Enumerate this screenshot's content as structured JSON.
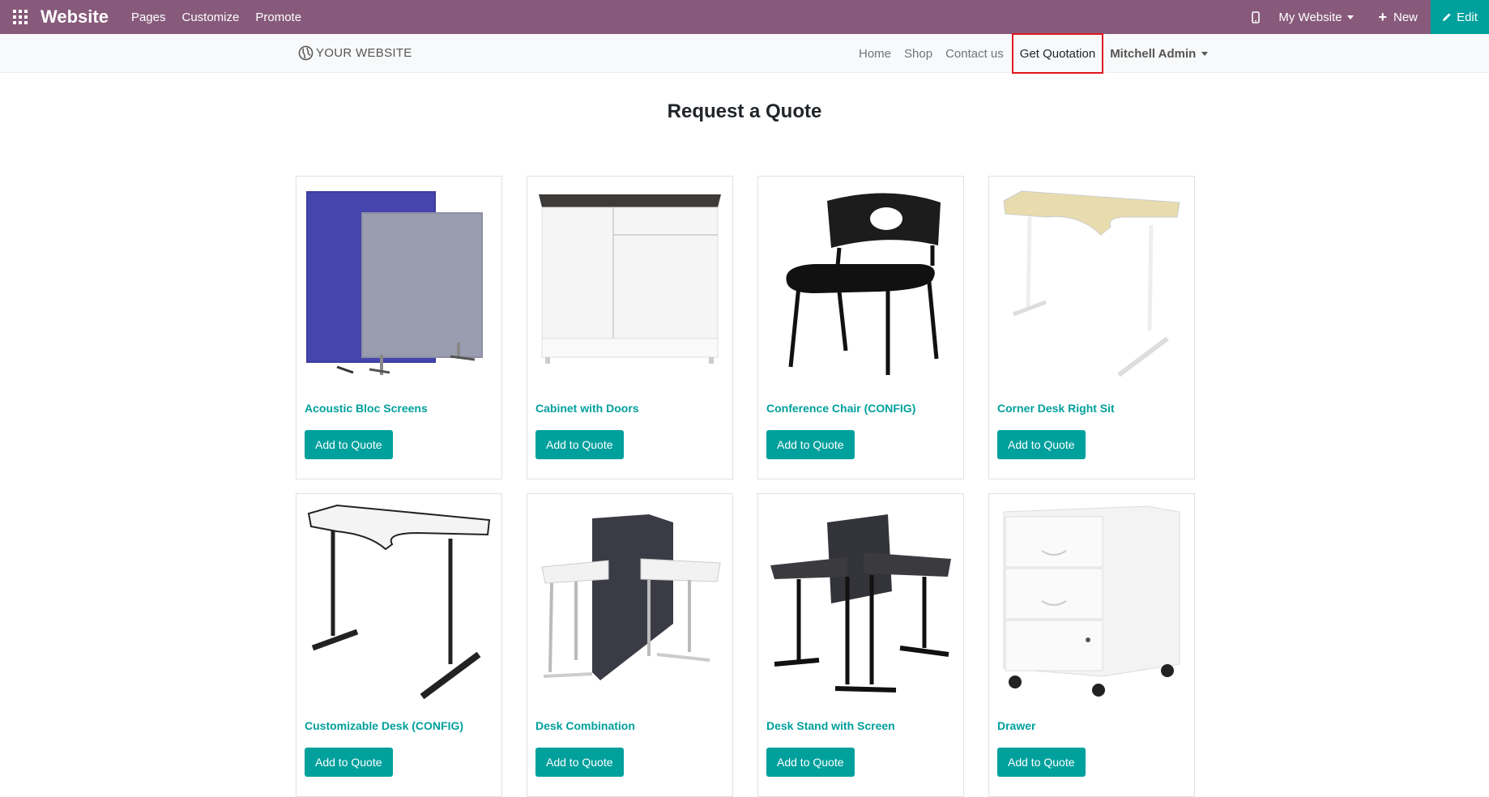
{
  "admin_bar": {
    "app_name": "Website",
    "menu": [
      "Pages",
      "Customize",
      "Promote"
    ],
    "website_selector": "My Website",
    "new_label": "New",
    "edit_label": "Edit",
    "bg_color": "#875a7b",
    "edit_color": "#00a09d"
  },
  "site_header": {
    "logo_text": "YOUR WEBSITE",
    "nav": [
      "Home",
      "Shop",
      "Contact us",
      "Get Quotation"
    ],
    "active_nav": "Get Quotation",
    "user": "Mitchell Admin"
  },
  "main": {
    "title": "Request a Quote",
    "button_label": "Add to Quote",
    "products": [
      {
        "name": "Acoustic Bloc Screens",
        "icon": "acoustic-screen"
      },
      {
        "name": "Cabinet with Doors",
        "icon": "cabinet"
      },
      {
        "name": "Conference Chair (CONFIG)",
        "icon": "chair"
      },
      {
        "name": "Corner Desk Right Sit",
        "icon": "corner-desk"
      },
      {
        "name": "Customizable Desk (CONFIG)",
        "icon": "desk"
      },
      {
        "name": "Desk Combination",
        "icon": "desk-combination"
      },
      {
        "name": "Desk Stand with Screen",
        "icon": "desk-stand"
      },
      {
        "name": "Drawer",
        "icon": "drawer"
      }
    ]
  }
}
